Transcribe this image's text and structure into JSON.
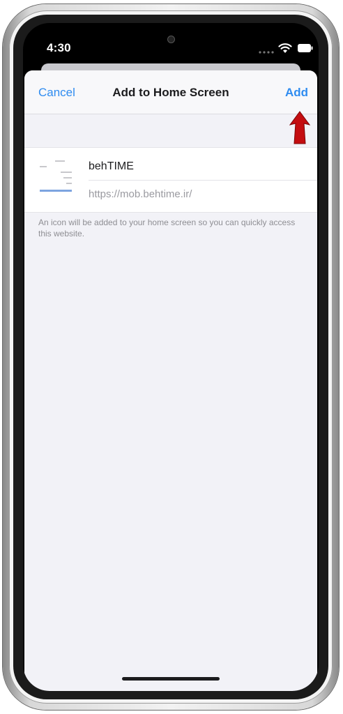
{
  "status_bar": {
    "time": "4:30",
    "icons": [
      "cellular-signal-icon",
      "wifi-icon",
      "battery-icon"
    ]
  },
  "nav": {
    "cancel_label": "Cancel",
    "title": "Add to Home Screen",
    "add_label": "Add"
  },
  "form": {
    "name_value": "behTIME",
    "url": "https://mob.behtime.ir/"
  },
  "footnote": "An icon will be added to your home screen so you can quickly access this website.",
  "colors": {
    "accent": "#2f8cf0",
    "annotation_arrow": "#c40d10",
    "sheet_background": "#f2f2f7"
  }
}
